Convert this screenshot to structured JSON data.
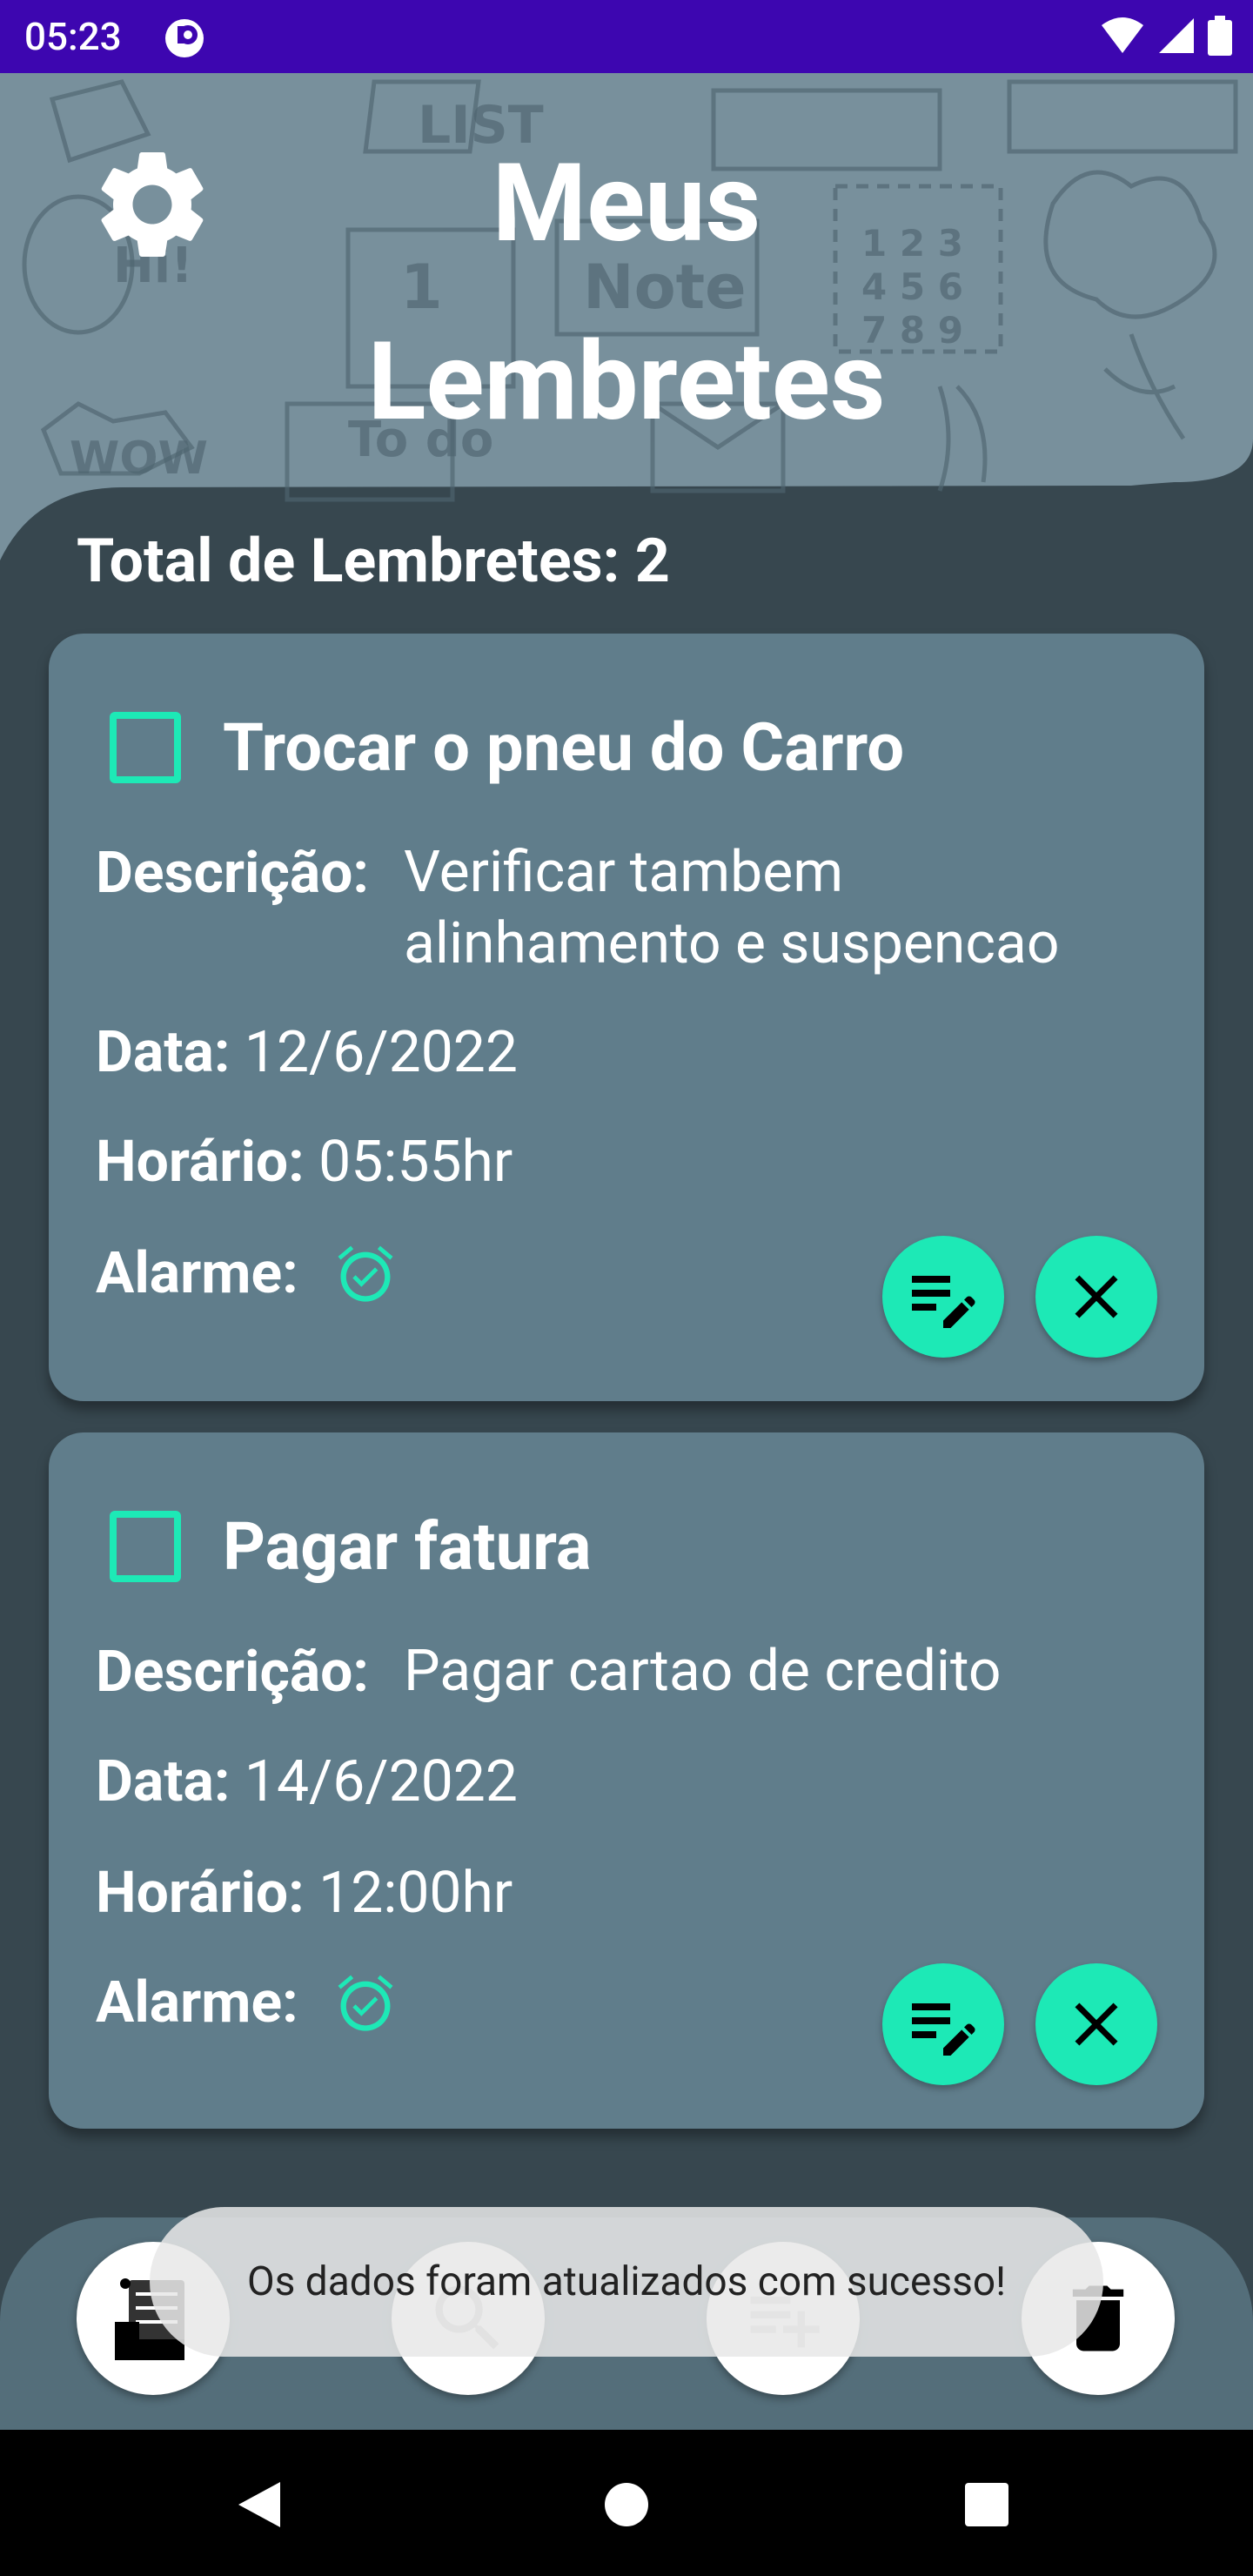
{
  "status_bar": {
    "time": "05:23"
  },
  "header": {
    "title_line1": "Meus",
    "title_line2": "Lembretes"
  },
  "summary": {
    "total_label": "Total de Lembretes: 2"
  },
  "labels": {
    "descricao": "Descrição:",
    "data": "Data:",
    "horario": "Horário:",
    "alarme": "Alarme:"
  },
  "reminders": [
    {
      "title": "Trocar o pneu do Carro",
      "description_line1": "Verificar tambem",
      "description_line2": "alinhamento e suspencao",
      "date": "12/6/2022",
      "time": "05:55hr",
      "checked": false,
      "alarm_icon": "alarm-check-icon"
    },
    {
      "title": "Pagar fatura",
      "description_line1": "Pagar cartao de credito",
      "date": "14/6/2022",
      "time": "12:00hr",
      "checked": false,
      "alarm_icon": "alarm-check-icon"
    }
  ],
  "bottom_nav": [
    {
      "icon": "list-calendar-icon"
    },
    {
      "icon": "search-icon"
    },
    {
      "icon": "playlist-add-icon"
    },
    {
      "icon": "delete-icon"
    }
  ],
  "toast": {
    "message": "Os dados foram atualizados com sucesso!"
  },
  "colors": {
    "status_bar": "#3d06b0",
    "background": "#37474f",
    "card": "#607d8b",
    "accent": "#1de9b6",
    "header_doodle_bg": "#78909c"
  }
}
